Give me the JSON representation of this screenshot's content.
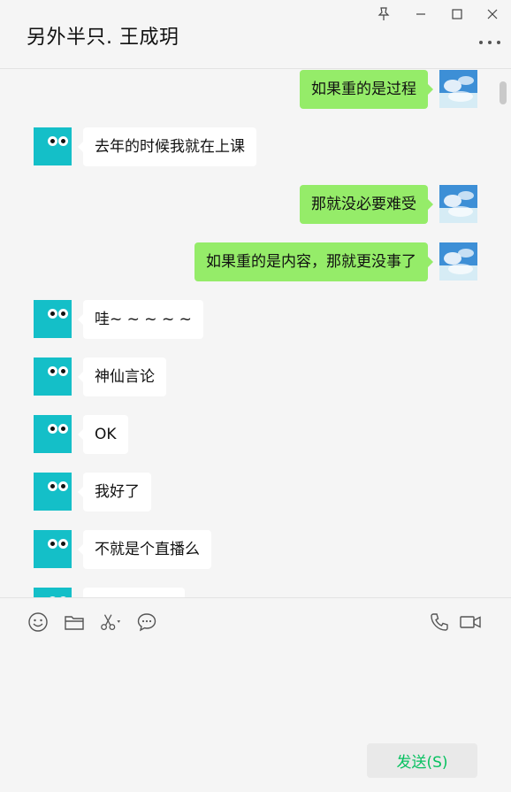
{
  "window": {
    "title": "另外半只. 王成玥",
    "controls": [
      {
        "name": "pin-icon"
      },
      {
        "name": "minimize-icon"
      },
      {
        "name": "maximize-icon"
      },
      {
        "name": "close-icon"
      }
    ],
    "more_icon": "more-icon"
  },
  "colors": {
    "self_bubble": "#95ec69",
    "peer_bubble": "#ffffff",
    "peer_avatar": "#14bfc8",
    "send_text": "#07c160",
    "background": "#f5f5f5"
  },
  "messages": [
    {
      "from": "self",
      "text": "如果重的是过程"
    },
    {
      "from": "peer",
      "text": "去年的时候我就在上课"
    },
    {
      "from": "self",
      "text": "那就没必要难受"
    },
    {
      "from": "self",
      "text": "如果重的是内容，那就更没事了"
    },
    {
      "from": "peer",
      "text": "哇~ ~ ~ ~ ~"
    },
    {
      "from": "peer",
      "text": "神仙言论"
    },
    {
      "from": "peer",
      "text": "OK"
    },
    {
      "from": "peer",
      "text": "我好了"
    },
    {
      "from": "peer",
      "text": "不就是个直播么"
    },
    {
      "from": "peer",
      "text": ""
    }
  ],
  "toolbar": {
    "left": [
      "emoji-icon",
      "folder-icon",
      "scissors-icon",
      "chat-bubble-icon"
    ],
    "right": [
      "phone-icon",
      "video-icon"
    ]
  },
  "input": {
    "value": ""
  },
  "send_button": {
    "label": "发送(S)"
  }
}
